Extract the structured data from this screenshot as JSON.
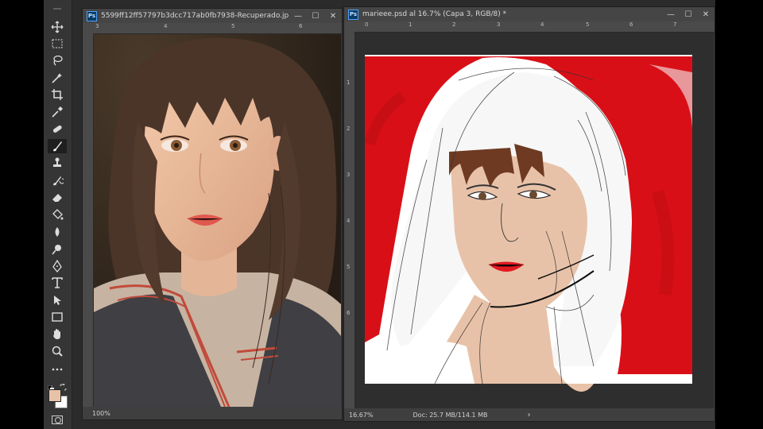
{
  "app": {
    "tools": [
      {
        "name": "move-tool-icon"
      },
      {
        "name": "marquee-tool-icon"
      },
      {
        "name": "lasso-tool-icon"
      },
      {
        "name": "magic-wand-tool-icon"
      },
      {
        "name": "crop-tool-icon"
      },
      {
        "name": "eyedropper-tool-icon"
      },
      {
        "name": "healing-brush-tool-icon"
      },
      {
        "name": "brush-tool-icon"
      },
      {
        "name": "clone-stamp-tool-icon"
      },
      {
        "name": "history-brush-tool-icon"
      },
      {
        "name": "eraser-tool-icon"
      },
      {
        "name": "paint-bucket-tool-icon"
      },
      {
        "name": "blur-tool-icon"
      },
      {
        "name": "dodge-tool-icon"
      },
      {
        "name": "pen-tool-icon"
      },
      {
        "name": "type-tool-icon"
      },
      {
        "name": "path-selection-tool-icon"
      },
      {
        "name": "rectangle-tool-icon"
      },
      {
        "name": "hand-tool-icon"
      },
      {
        "name": "zoom-tool-icon"
      },
      {
        "name": "more-tools-icon"
      }
    ]
  },
  "colors": {
    "foreground": "#e8c2a8",
    "background": "#ffffff",
    "accent_red": "#d90f17"
  },
  "doc_reference": {
    "badge": "Ps",
    "title": "5599ff12ff57797b3dcc717ab0fb7938-Recuperado.jp...",
    "zoom": "100%",
    "ruler_marks": [
      "3",
      "4",
      "5",
      "6"
    ]
  },
  "doc_main": {
    "badge": "Ps",
    "title": "marieee.psd al 16.7% (Capa 3, RGB/8) *",
    "zoom": "16.67%",
    "doc_size": "Doc: 25.7 MB/114.1 MB",
    "arrow": "›",
    "ruler_marks": [
      "0",
      "1",
      "2",
      "3",
      "4",
      "5",
      "6",
      "7"
    ],
    "vruler_marks": [
      "1",
      "2",
      "3",
      "4",
      "5",
      "6"
    ]
  },
  "window_buttons": {
    "minimize": "—",
    "maximize": "☐",
    "close": "✕"
  }
}
